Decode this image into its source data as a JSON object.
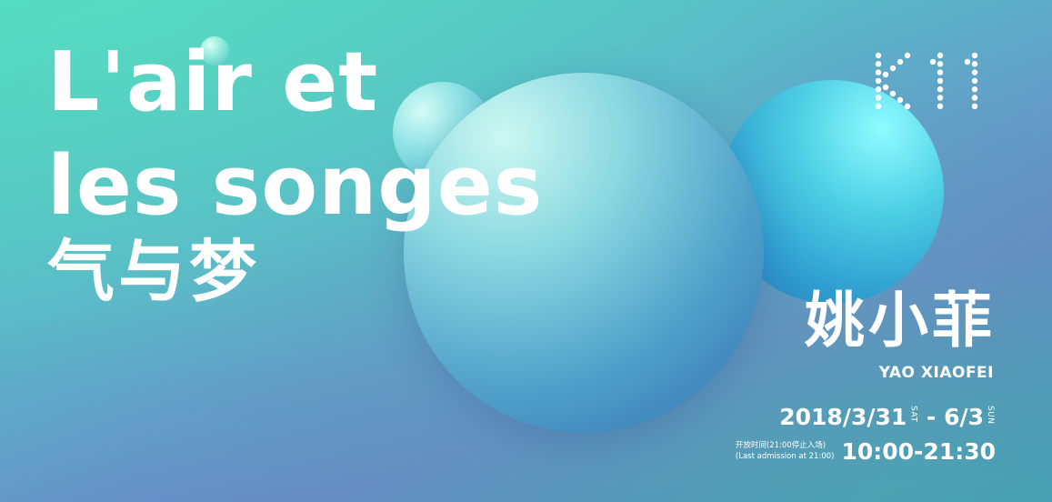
{
  "title_line1": "L'air et",
  "title_line2": "les songes",
  "title_cn": "气与梦",
  "logo_text": "K11",
  "artist_cn": "姚小菲",
  "artist_en": "YAO XIAOFEI",
  "dates": {
    "start": "2018/3/31",
    "start_day": "SAT",
    "separator": " - ",
    "end": "6/3",
    "end_day": "SUN"
  },
  "hours": {
    "note_cn": "开放时间(21:00停止入场)",
    "note_en": "(Last admission at 21:00)",
    "time": "10:00-21:30"
  }
}
